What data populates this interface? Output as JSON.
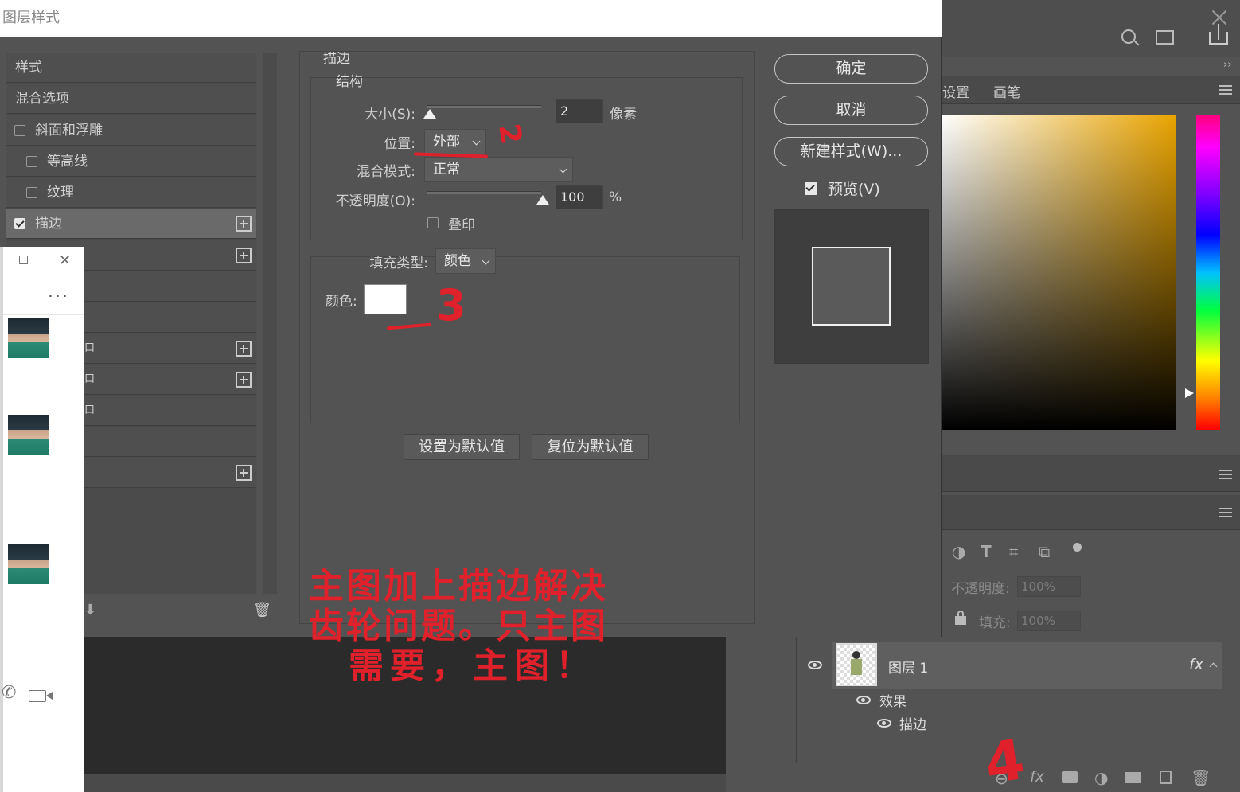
{
  "dialog": {
    "title": "图层样式",
    "buttons": {
      "ok": "确定",
      "cancel": "取消",
      "new_style": "新建样式(W)...",
      "preview": "预览(V)"
    },
    "preview_checked": true
  },
  "style_list": {
    "items": [
      {
        "label": "样式",
        "checkbox": false,
        "checked": false,
        "plus": false,
        "selected": false
      },
      {
        "label": "混合选项",
        "checkbox": false,
        "checked": false,
        "plus": false,
        "selected": false
      },
      {
        "label": "斜面和浮雕",
        "checkbox": true,
        "checked": false,
        "plus": false,
        "selected": false
      },
      {
        "label": "等高线",
        "checkbox": true,
        "checked": false,
        "plus": false,
        "selected": false
      },
      {
        "label": "纹理",
        "checkbox": true,
        "checked": false,
        "plus": false,
        "selected": false
      },
      {
        "label": "描边",
        "checkbox": true,
        "checked": true,
        "plus": true,
        "selected": true
      }
    ],
    "partial_fragments": [
      "口",
      "口",
      "口"
    ]
  },
  "stroke": {
    "section_title": "描边",
    "structure_title": "结构",
    "size_label": "大小(S):",
    "size_value": "2",
    "size_unit": "像素",
    "position_label": "位置:",
    "position_value": "外部",
    "blend_label": "混合模式:",
    "blend_value": "正常",
    "opacity_label": "不透明度(O):",
    "opacity_value": "100",
    "opacity_unit": "%",
    "overprint_label": "叠印",
    "fill_type_label": "填充类型:",
    "fill_type_value": "颜色",
    "color_label": "颜色:",
    "color_value": "#ffffff",
    "set_default": "设置为默认值",
    "reset_default": "复位为默认值"
  },
  "right_panel": {
    "tabs": [
      "设置",
      "画笔"
    ],
    "opacity_label": "不透明度:",
    "opacity_value": "100%",
    "fill_label": "填充:",
    "fill_value": "100%",
    "layer_name": "图层 1",
    "fx": "fx",
    "effects_label": "效果",
    "stroke_effect_label": "描边",
    "footer_fx": "fx"
  },
  "annotations": {
    "mark_2": "2",
    "mark_3": "3",
    "mark_4": "4",
    "note_line1": "主图加上描边解决",
    "note_line2": "齿轮问题。只主图",
    "note_line3": "需要，主图！"
  },
  "colors": {
    "dialog_bg": "#535353",
    "annotation_red": "#e0202a",
    "stroke_color": "#ffffff"
  }
}
